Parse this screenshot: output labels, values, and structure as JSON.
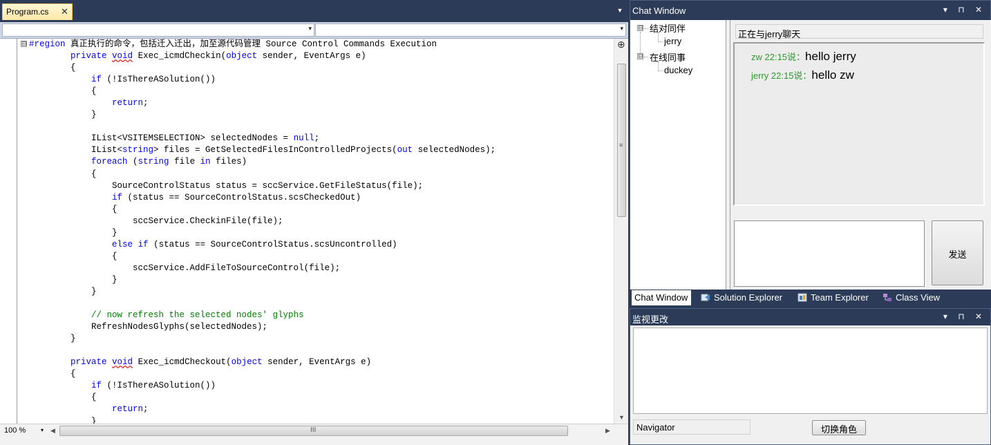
{
  "editor": {
    "tab_title": "Program.cs",
    "tab_close": "✕",
    "tab_menu": "▼",
    "combo_arrow": "▾",
    "outline_toggle": "⊟",
    "split_icon": "⊕",
    "vscroll_grip": "≡",
    "hscroll_grip": "III",
    "scroll_down": "▼",
    "scroll_left": "◀",
    "scroll_right": "▶",
    "zoom": "100 %",
    "zoom_arrow": "▾",
    "code_lines": [
      "#region 真正执行的命令，包括迁入迁出，加至源代码管理 Source Control Commands Execution",
      "        private void Exec_icmdCheckin(object sender, EventArgs e)",
      "        {",
      "            if (!IsThereASolution())",
      "            {",
      "                return;",
      "            }",
      "",
      "            IList<VSITEMSELECTION> selectedNodes = null;",
      "            IList<string> files = GetSelectedFilesInControlledProjects(out selectedNodes);",
      "            foreach (string file in files)",
      "            {",
      "                SourceControlStatus status = sccService.GetFileStatus(file);",
      "                if (status == SourceControlStatus.scsCheckedOut)",
      "                {",
      "                    sccService.CheckinFile(file);",
      "                }",
      "                else if (status == SourceControlStatus.scsUncontrolled)",
      "                {",
      "                    sccService.AddFileToSourceControl(file);",
      "                }",
      "            }",
      "",
      "            // now refresh the selected nodes' glyphs",
      "            RefreshNodesGlyphs(selectedNodes);",
      "        }",
      "",
      "        private void Exec_icmdCheckout(object sender, EventArgs e)",
      "        {",
      "            if (!IsThereASolution())",
      "            {",
      "                return;",
      "            }"
    ]
  },
  "chat": {
    "title": "Chat Window",
    "title_controls": "▾ ⊓ ✕",
    "tree": {
      "group1": "结对同伴",
      "group1_toggle": "⊟",
      "user1": "jerry",
      "group2": "在线同事",
      "group2_toggle": "⊟",
      "user2": "duckey"
    },
    "header": "正在与jerry聊天",
    "messages": [
      {
        "who": "zw 22:15说：",
        "text": "hello jerry"
      },
      {
        "who": "jerry 22:15说：",
        "text": "hello zw"
      }
    ],
    "send_label": "发送"
  },
  "tool_tabs": [
    {
      "label": "Chat Window",
      "icon": ""
    },
    {
      "label": "Solution Explorer",
      "icon": "solution-explorer-icon"
    },
    {
      "label": "Team Explorer",
      "icon": "team-explorer-icon"
    },
    {
      "label": "Class View",
      "icon": "class-view-icon"
    }
  ],
  "watch": {
    "title": "监视更改",
    "title_controls": "▾ ⊓ ✕",
    "navigator_label": "Navigator",
    "switch_label": "切换角色"
  }
}
